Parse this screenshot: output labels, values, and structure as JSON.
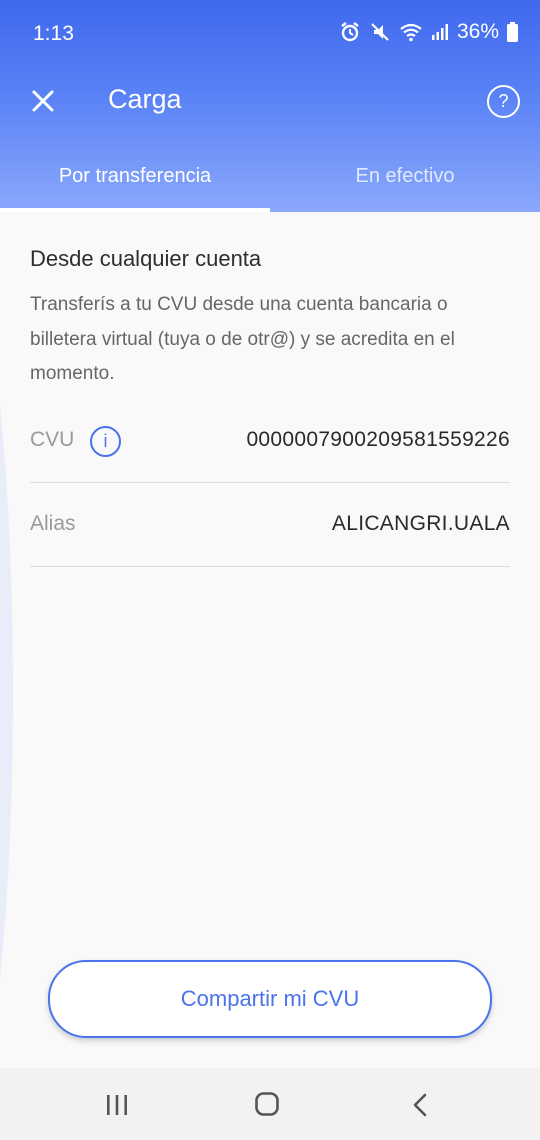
{
  "status_bar": {
    "time": "1:13",
    "battery_text": "36%",
    "icons": [
      "alarm-icon",
      "mute-icon",
      "wifi-icon",
      "signal-icon",
      "battery-icon"
    ]
  },
  "header": {
    "title": "Carga",
    "close_icon": "close-icon",
    "help_icon": "help-icon",
    "help_glyph": "?"
  },
  "tabs": [
    {
      "label": "Por transferencia",
      "active": true
    },
    {
      "label": "En efectivo",
      "active": false
    }
  ],
  "section": {
    "title": "Desde cualquier cuenta",
    "description": "Transferís a tu CVU desde una cuenta bancaria o billetera virtual (tuya o de otr@) y se acredita en el momento."
  },
  "fields": {
    "cvu": {
      "label": "CVU",
      "value": "0000007900209581559226",
      "info_glyph": "i"
    },
    "alias": {
      "label": "Alias",
      "value": "ALICANGRI.UALA"
    }
  },
  "actions": {
    "share_label": "Compartir mi CVU"
  },
  "nav_bar": {
    "icons": [
      "recents-icon",
      "home-icon",
      "back-icon"
    ]
  },
  "colors": {
    "accent": "#4b73ee",
    "header_gradient_top": "#3f68ee",
    "header_gradient_bottom": "#8aa8fb",
    "background": "#f9f9f9"
  }
}
